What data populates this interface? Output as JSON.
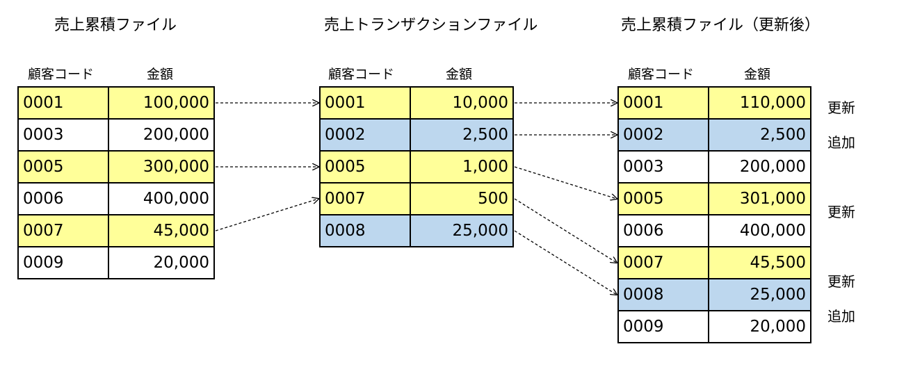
{
  "tables": [
    {
      "title": "売上累積ファイル",
      "col_code": "顧客コード",
      "col_amount": "金額",
      "rows": [
        {
          "code": "0001",
          "amount": "100,000",
          "color": "yellow"
        },
        {
          "code": "0003",
          "amount": "200,000",
          "color": "white"
        },
        {
          "code": "0005",
          "amount": "300,000",
          "color": "yellow"
        },
        {
          "code": "0006",
          "amount": "400,000",
          "color": "white"
        },
        {
          "code": "0007",
          "amount": "45,000",
          "color": "yellow"
        },
        {
          "code": "0009",
          "amount": "20,000",
          "color": "white"
        }
      ]
    },
    {
      "title": "売上トランザクションファイル",
      "col_code": "顧客コード",
      "col_amount": "金額",
      "rows": [
        {
          "code": "0001",
          "amount": "10,000",
          "color": "yellow"
        },
        {
          "code": "0002",
          "amount": "2,500",
          "color": "blue"
        },
        {
          "code": "0005",
          "amount": "1,000",
          "color": "yellow"
        },
        {
          "code": "0007",
          "amount": "500",
          "color": "yellow"
        },
        {
          "code": "0008",
          "amount": "25,000",
          "color": "blue"
        }
      ]
    },
    {
      "title": "売上累積ファイル（更新後）",
      "col_code": "顧客コード",
      "col_amount": "金額",
      "rows": [
        {
          "code": "0001",
          "amount": "110,000",
          "color": "yellow",
          "status": "更新"
        },
        {
          "code": "0002",
          "amount": "2,500",
          "color": "blue",
          "status": "追加"
        },
        {
          "code": "0003",
          "amount": "200,000",
          "color": "white",
          "status": ""
        },
        {
          "code": "0005",
          "amount": "301,000",
          "color": "yellow",
          "status": "更新"
        },
        {
          "code": "0006",
          "amount": "400,000",
          "color": "white",
          "status": ""
        },
        {
          "code": "0007",
          "amount": "45,500",
          "color": "yellow",
          "status": "更新"
        },
        {
          "code": "0008",
          "amount": "25,000",
          "color": "blue",
          "status": "追加"
        },
        {
          "code": "0009",
          "amount": "20,000",
          "color": "white",
          "status": ""
        }
      ]
    }
  ],
  "arrows": [
    {
      "from_table": 0,
      "from_row": 0,
      "to_table": 1,
      "to_row": 0
    },
    {
      "from_table": 0,
      "from_row": 2,
      "to_table": 1,
      "to_row": 2
    },
    {
      "from_table": 0,
      "from_row": 4,
      "to_table": 1,
      "to_row": 3
    },
    {
      "from_table": 1,
      "from_row": 0,
      "to_table": 2,
      "to_row": 0
    },
    {
      "from_table": 1,
      "from_row": 1,
      "to_table": 2,
      "to_row": 1
    },
    {
      "from_table": 1,
      "from_row": 2,
      "to_table": 2,
      "to_row": 3
    },
    {
      "from_table": 1,
      "from_row": 3,
      "to_table": 2,
      "to_row": 5
    },
    {
      "from_table": 1,
      "from_row": 4,
      "to_table": 2,
      "to_row": 6
    }
  ],
  "colors": {
    "yellow": "#ffff99",
    "blue": "#bdd7ee",
    "white": "#ffffff"
  }
}
